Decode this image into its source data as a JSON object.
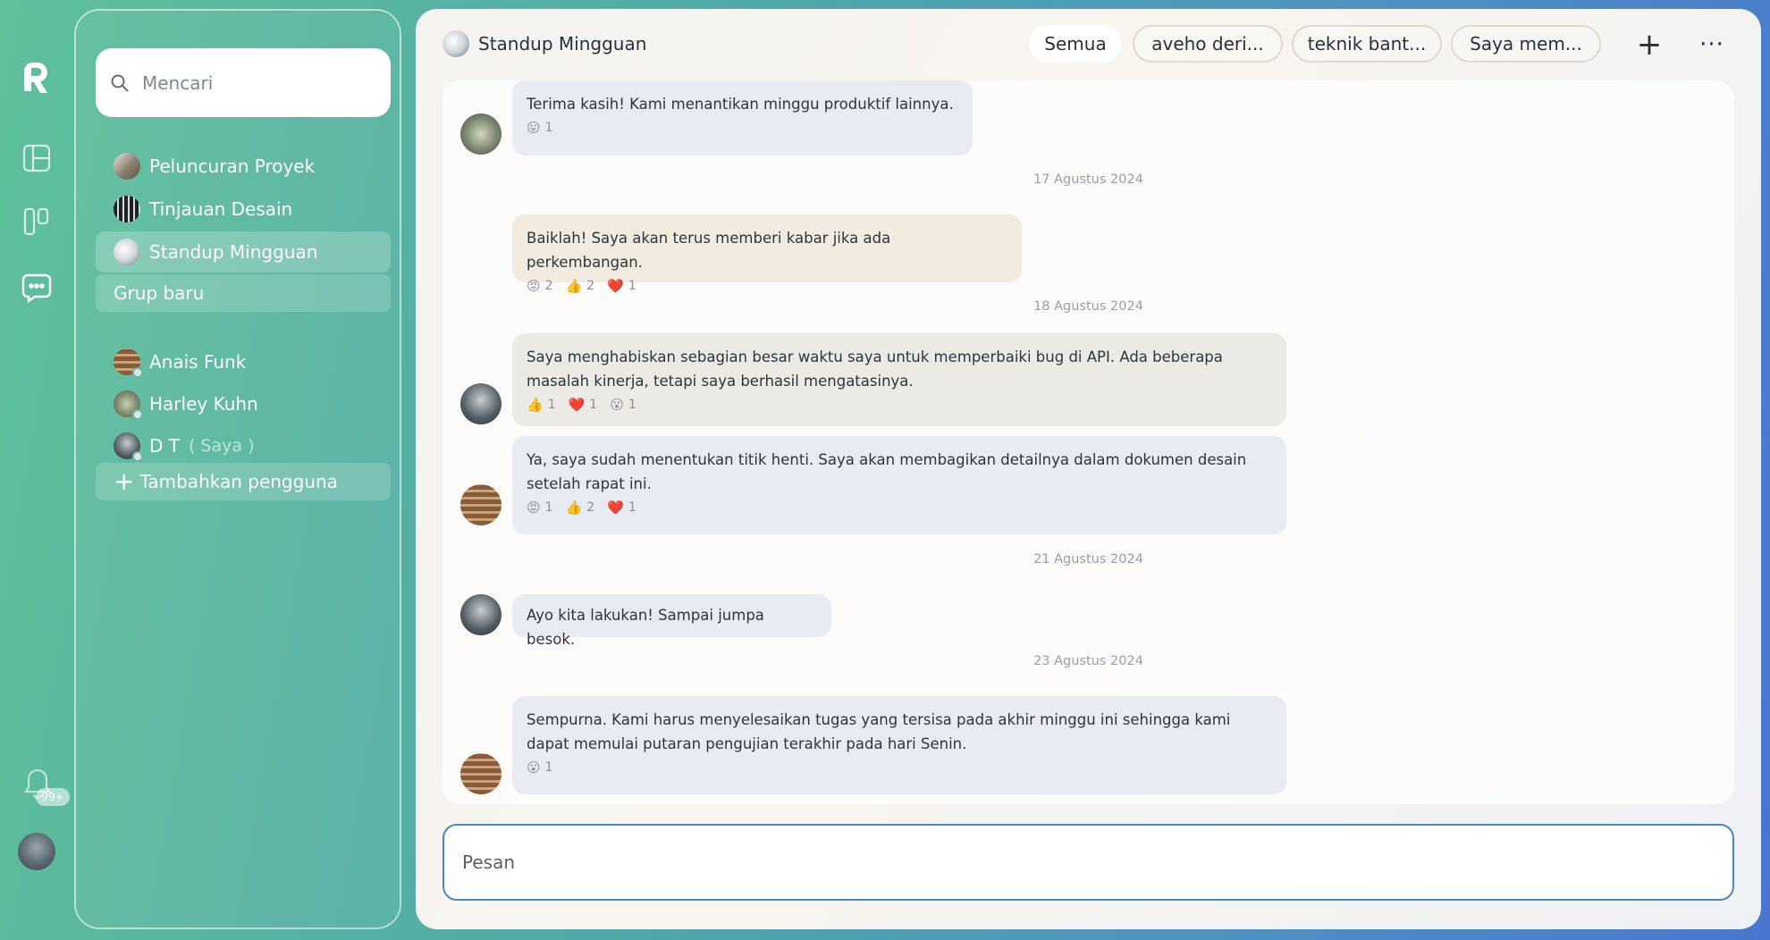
{
  "rail": {
    "badge_count": "99+"
  },
  "search": {
    "placeholder": "Mencari"
  },
  "groups": [
    {
      "label": "Peluncuran Proyek"
    },
    {
      "label": "Tinjauan Desain"
    },
    {
      "label": "Standup Mingguan"
    }
  ],
  "new_group_label": "Grup baru",
  "users": [
    {
      "label": "Anais Funk",
      "suffix": ""
    },
    {
      "label": "Harley Kuhn",
      "suffix": ""
    },
    {
      "label": "D T",
      "suffix": "( Saya )"
    }
  ],
  "add_user_label": "Tambahkan pengguna",
  "header": {
    "title": "Standup Mingguan",
    "tabs": [
      "Semua",
      "aveho deri...",
      "teknik bant...",
      "Saya mem..."
    ],
    "more_glyph": "···"
  },
  "messages": [
    {
      "text": "Terima kasih! Kami menantikan minggu produktif lainnya.",
      "reactions": [
        {
          "emoji": "😛",
          "count": "1"
        }
      ]
    },
    {
      "date": "17 Agustus 2024"
    },
    {
      "text": "Baiklah! Saya akan terus memberi kabar jika ada perkembangan.",
      "reactions": [
        {
          "emoji": "😡",
          "count": "2"
        },
        {
          "emoji": "👍",
          "count": "2"
        },
        {
          "emoji": "❤️",
          "count": "1"
        }
      ]
    },
    {
      "date": "18 Agustus 2024"
    },
    {
      "text": "Saya menghabiskan sebagian besar waktu saya untuk memperbaiki bug di API. Ada beberapa masalah kinerja, tetapi saya berhasil mengatasinya.",
      "reactions": [
        {
          "emoji": "👍",
          "count": "1"
        },
        {
          "emoji": "❤️",
          "count": "1"
        },
        {
          "emoji": "😮",
          "count": "1"
        }
      ]
    },
    {
      "text": "Ya, saya sudah menentukan titik henti. Saya akan membagikan detailnya dalam dokumen desain setelah rapat ini.",
      "reactions": [
        {
          "emoji": "😡",
          "count": "1"
        },
        {
          "emoji": "👍",
          "count": "2"
        },
        {
          "emoji": "❤️",
          "count": "1"
        }
      ]
    },
    {
      "date": "21 Agustus 2024"
    },
    {
      "text": "Ayo kita lakukan! Sampai jumpa besok.",
      "reactions": []
    },
    {
      "date": "23 Agustus 2024"
    },
    {
      "text": "Sempurna. Kami harus menyelesaikan tugas yang tersisa pada akhir minggu ini sehingga kami dapat memulai putaran pengujian terakhir pada hari Senin.",
      "reactions": [
        {
          "emoji": "😮",
          "count": "1"
        }
      ]
    }
  ],
  "composer": {
    "placeholder": "Pesan"
  }
}
